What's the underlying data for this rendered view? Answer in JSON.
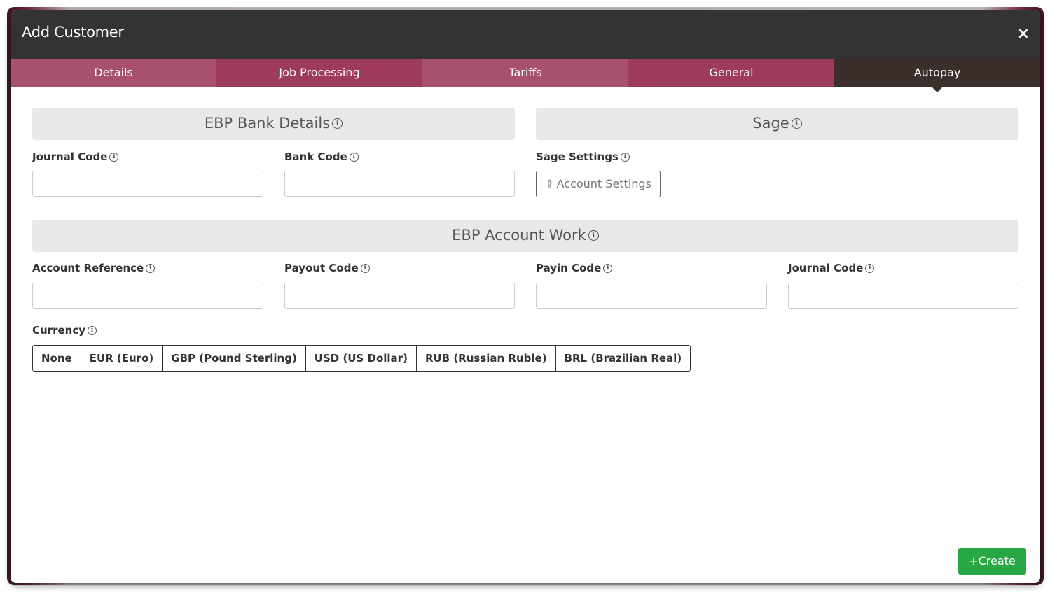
{
  "modal": {
    "title": "Add Customer",
    "close_glyph": "×"
  },
  "tabs": [
    {
      "label": "Details"
    },
    {
      "label": "Job Processing"
    },
    {
      "label": "Tariffs"
    },
    {
      "label": "General"
    },
    {
      "label": "Autopay",
      "active": true
    }
  ],
  "bank_details": {
    "heading": "EBP Bank Details",
    "journal_code_label": "Journal Code",
    "bank_code_label": "Bank Code",
    "journal_code_value": "",
    "bank_code_value": ""
  },
  "sage": {
    "heading": "Sage",
    "settings_label": "Sage Settings",
    "account_settings_button": "Account Settings"
  },
  "account_work": {
    "heading": "EBP Account Work",
    "account_reference_label": "Account Reference",
    "payout_code_label": "Payout Code",
    "payin_code_label": "Payin Code",
    "journal_code_label": "Journal Code",
    "account_reference_value": "",
    "payout_code_value": "",
    "payin_code_value": "",
    "journal_code_value": ""
  },
  "currency": {
    "label": "Currency",
    "options": [
      "None",
      "EUR (Euro)",
      "GBP (Pound Sterling)",
      "USD (US Dollar)",
      "RUB (Russian Ruble)",
      "BRL (Brazilian Real)"
    ]
  },
  "footer": {
    "create_label": "Create",
    "create_glyph": "+"
  },
  "colors": {
    "header_bg": "#333333",
    "tab_light": "#a8516f",
    "tab_dark": "#9e3a5e",
    "tab_active": "#3b2f2c",
    "create_btn": "#28a745"
  }
}
